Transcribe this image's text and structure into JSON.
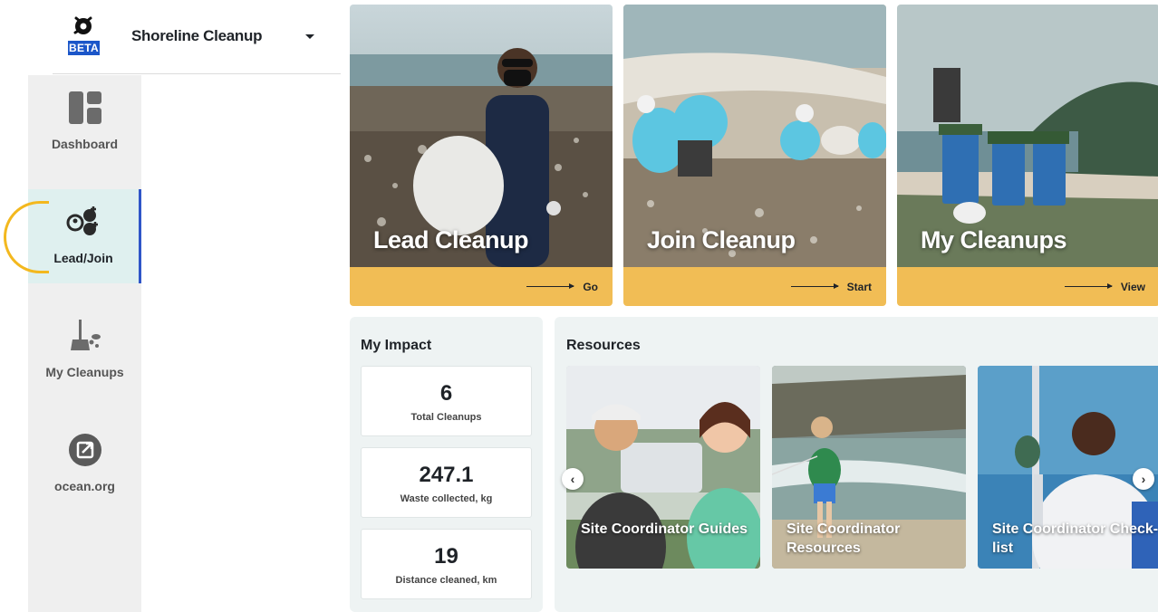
{
  "header": {
    "title": "Shoreline Cleanup",
    "badge": "BETA"
  },
  "sidebar": {
    "items": [
      {
        "label": "Dashboard",
        "icon": "dashboard-icon"
      },
      {
        "label": "Lead/Join",
        "icon": "people-add-icon",
        "active": true
      },
      {
        "label": "My Cleanups",
        "icon": "broom-icon"
      },
      {
        "label": "ocean.org",
        "icon": "external-link-icon"
      }
    ]
  },
  "cards": [
    {
      "title": "Lead Cleanup",
      "action": "Go"
    },
    {
      "title": "Join Cleanup",
      "action": "Start"
    },
    {
      "title": "My Cleanups",
      "action": "View"
    }
  ],
  "impact": {
    "heading": "My Impact",
    "stats": [
      {
        "value": "6",
        "label": "Total Cleanups"
      },
      {
        "value": "247.1",
        "label": "Waste collected, kg"
      },
      {
        "value": "19",
        "label": "Distance cleaned, km"
      }
    ]
  },
  "resources": {
    "heading": "Resources",
    "items": [
      {
        "title": "Site Coordinator Guides"
      },
      {
        "title": "Site Coordinator Resources"
      },
      {
        "title": "Site Coordinator Check-list"
      }
    ],
    "prev_icon": "chevron-left-icon",
    "next_icon": "chevron-right-icon"
  },
  "colors": {
    "accent_bar": "#f1bd55",
    "active_nav_bg": "#dff0ef",
    "active_nav_border": "#2f55c8",
    "badge_blue": "#1b56c9",
    "highlight_ring": "#f3b81e"
  }
}
